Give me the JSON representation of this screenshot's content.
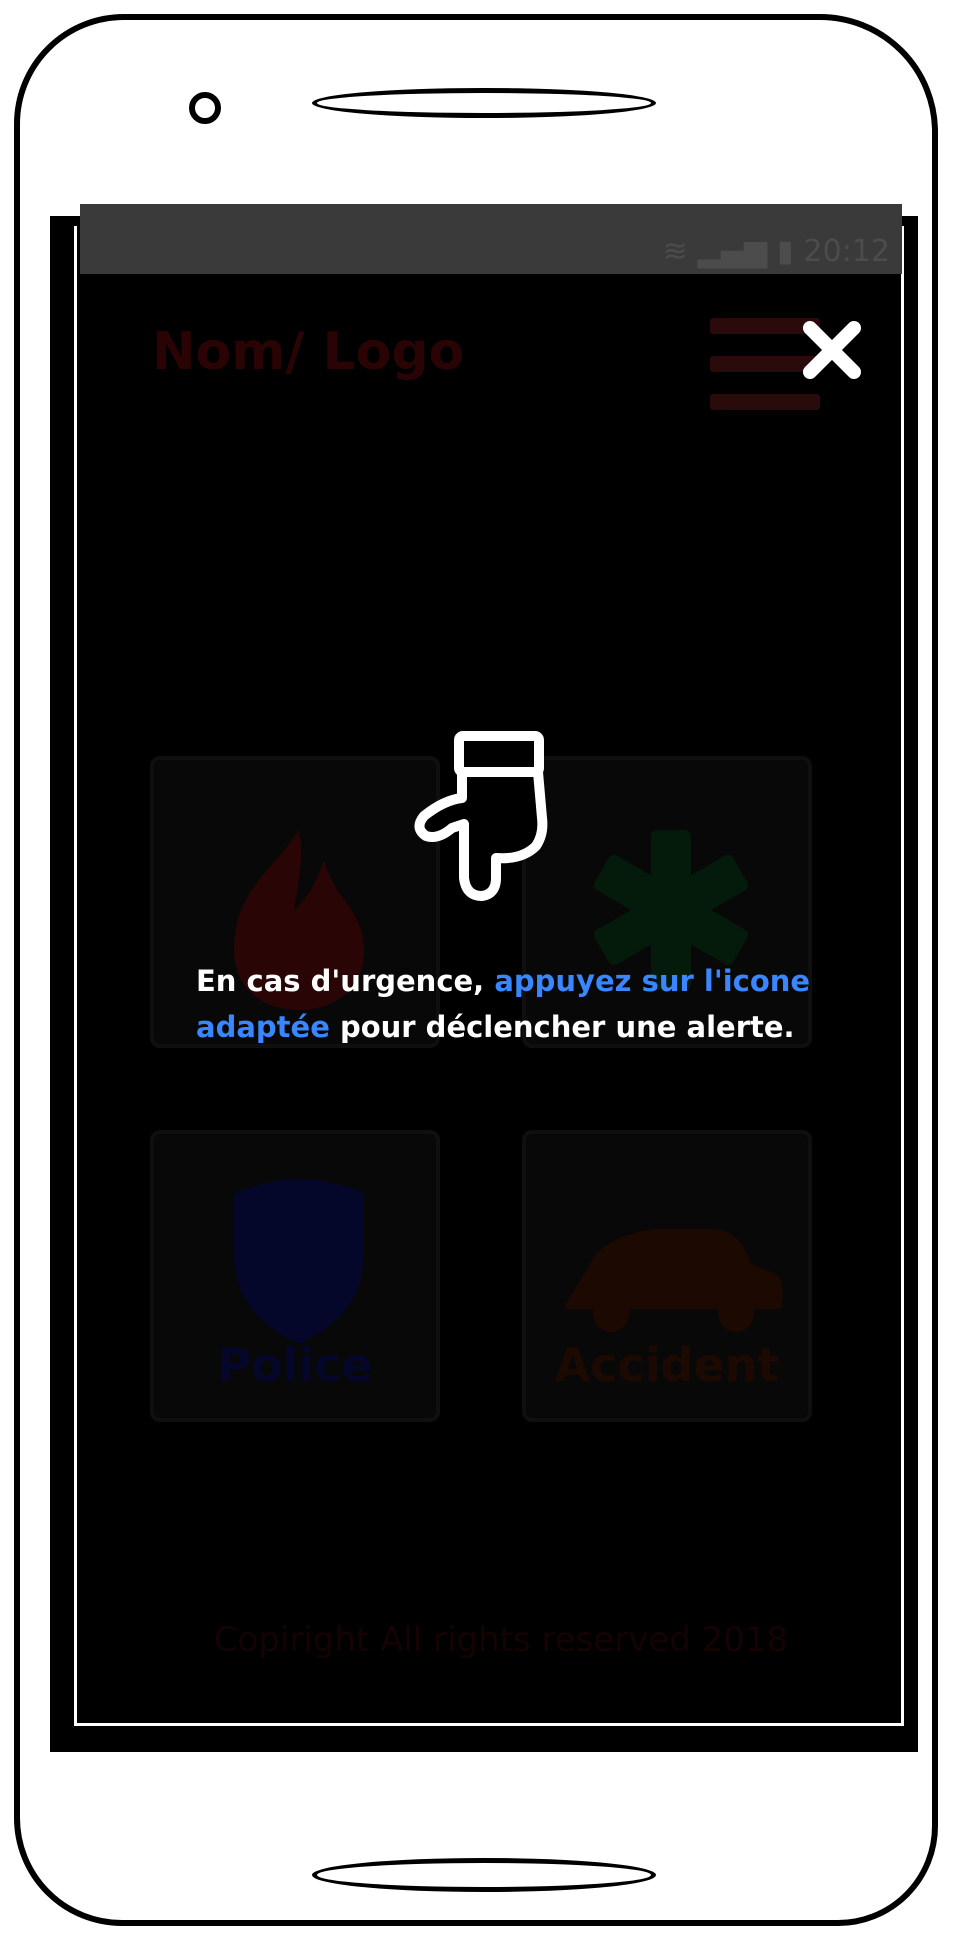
{
  "status_bar": {
    "time": "20:12",
    "wifi_icon": "wifi-icon",
    "signal_icon": "signal-icon",
    "battery_icon": "battery-icon"
  },
  "header": {
    "logo_text": "Nom/ Logo",
    "menu_icon": "hamburger-icon",
    "close_icon": "close-icon"
  },
  "tiles": [
    {
      "label": "",
      "icon": "fire-icon",
      "color": "#2a0505"
    },
    {
      "label": "",
      "icon": "medical-star-icon",
      "color": "#041a0a"
    },
    {
      "label": "Police",
      "icon": "police-shield-icon",
      "color": "#04072a"
    },
    {
      "label": "Accident",
      "icon": "car-crash-icon",
      "color": "#1c0a02"
    }
  ],
  "overlay": {
    "icon": "pointing-hand-icon",
    "text_part1": "En cas d'urgence, ",
    "text_highlight": "appuyez sur l'icone adaptée",
    "text_part2": " pour déclencher une alerte.",
    "highlight_color": "#3a86ff"
  },
  "footer": {
    "copyright": "Copiright All rights reserved 2018"
  }
}
